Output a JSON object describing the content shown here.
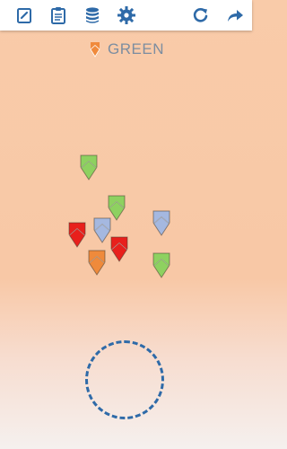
{
  "toolbar": {
    "buttons": [
      {
        "name": "edit-note-button",
        "icon": "edit-note-icon"
      },
      {
        "name": "clipboard-button",
        "icon": "clipboard-icon"
      },
      {
        "name": "database-button",
        "icon": "database-icon"
      },
      {
        "name": "settings-button",
        "icon": "gear-icon"
      },
      {
        "name": "restart-button",
        "icon": "restart-icon"
      },
      {
        "name": "share-button",
        "icon": "share-arrow-icon"
      }
    ],
    "icon_color": "#2e6aa8"
  },
  "status": {
    "label": "GREEN",
    "icon": "orange-piece-icon",
    "icon_color": "#f08a3c"
  },
  "colors": {
    "green": "#8ed160",
    "blue": "#a5b8e0",
    "red": "#e8201c",
    "orange": "#ef8a3b"
  },
  "pieces": [
    {
      "color": "green"
    },
    {
      "color": "green"
    },
    {
      "color": "blue"
    },
    {
      "color": "red"
    },
    {
      "color": "blue"
    },
    {
      "color": "red"
    },
    {
      "color": "orange"
    },
    {
      "color": "green"
    }
  ],
  "target": {
    "icon": "dashed-circle-target"
  }
}
